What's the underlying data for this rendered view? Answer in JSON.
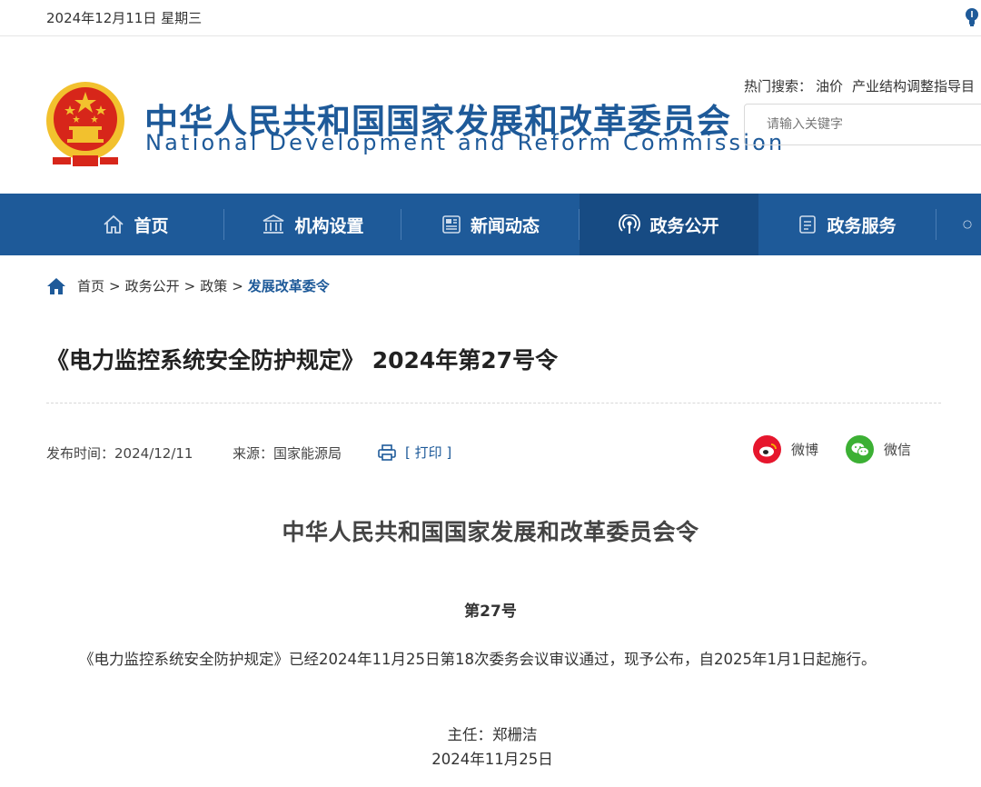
{
  "topbar": {
    "date": "2024年12月11日 星期三",
    "icon": "lightbulb-icon"
  },
  "header": {
    "site_name_cn": "中华人民共和国国家发展和改革委员会",
    "site_name_en": "National Development and Reform Commission",
    "hot_search_label": "热门搜索：",
    "hot_keywords": [
      "油价",
      "产业结构调整指导目"
    ],
    "search_placeholder": "请输入关键字"
  },
  "nav": {
    "items": [
      {
        "label": "首页",
        "icon": "home-icon"
      },
      {
        "label": "机构设置",
        "icon": "building-icon"
      },
      {
        "label": "新闻动态",
        "icon": "newspaper-icon"
      },
      {
        "label": "政务公开",
        "icon": "broadcast-icon",
        "active": true
      },
      {
        "label": "政务服务",
        "icon": "document-icon"
      }
    ]
  },
  "breadcrumb": {
    "items": [
      "首页",
      "政务公开",
      "政策"
    ],
    "separator": ">",
    "current": "发展改革委令"
  },
  "article": {
    "title": "《电力监控系统安全防护规定》 2024年第27号令",
    "publish_label": "发布时间：",
    "publish_date": "2024/12/11",
    "source_label": "来源：",
    "source": "国家能源局",
    "print_label": "[ 打印 ]",
    "share": [
      {
        "label": "微博",
        "icon": "weibo-icon",
        "color": "#e6162d"
      },
      {
        "label": "微信",
        "icon": "wechat-icon",
        "color": "#3cb034"
      }
    ],
    "doc_header": "中华人民共和国国家发展和改革委员会令",
    "doc_number": "第27号",
    "body": "《电力监控系统安全防护规定》已经2024年11月25日第18次委务会议审议通过，现予公布，自2025年1月1日起施行。",
    "signature_title": "主任：郑栅洁",
    "signature_date": "2024年11月25日"
  },
  "colors": {
    "brand_blue": "#1e5a99",
    "nav_active": "#174b83",
    "emblem_red": "#d7261a",
    "emblem_gold": "#f2c12e"
  }
}
